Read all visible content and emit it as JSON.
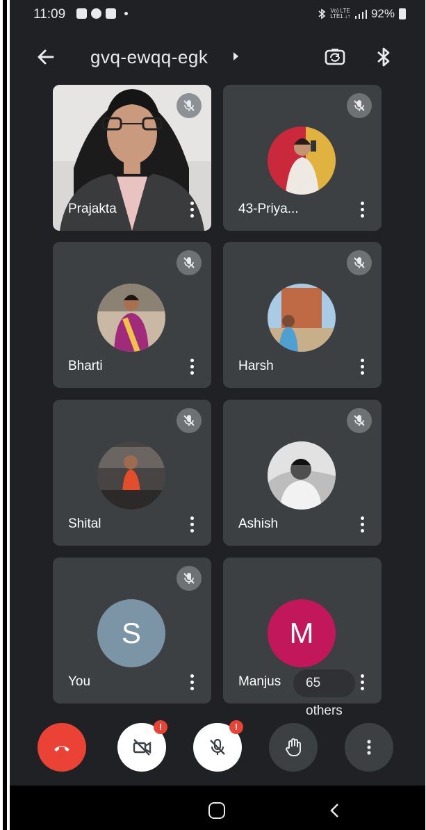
{
  "status_bar": {
    "time": "11:09",
    "net_top": "Vo) LTE",
    "net_bottom": "LTE1 ↓↑",
    "battery": "92%"
  },
  "header": {
    "meeting_code": "gvq-ewqq-egk",
    "back_icon": "arrow-left-icon",
    "switch_camera_icon": "switch-camera-icon",
    "bluetooth_icon": "bluetooth-icon"
  },
  "participants": [
    {
      "name": "Prajakta",
      "muted": true,
      "video_on": true
    },
    {
      "name": "43-Priya...",
      "muted": true,
      "video_on": false
    },
    {
      "name": "Bharti",
      "muted": true,
      "video_on": false
    },
    {
      "name": "Harsh",
      "muted": true,
      "video_on": false
    },
    {
      "name": "Shital",
      "muted": true,
      "video_on": false
    },
    {
      "name": "Ashish",
      "muted": true,
      "video_on": false
    },
    {
      "name": "You",
      "muted": true,
      "video_on": false,
      "initial": "S",
      "avatar_color": "#7b95a6"
    },
    {
      "name": "Manjus",
      "muted": false,
      "video_on": false,
      "initial": "M",
      "avatar_color": "#c2185b"
    }
  ],
  "others_label": "65 others",
  "controls": {
    "end_call_color": "#ea4335",
    "camera_badge": "!",
    "mic_badge": "!"
  }
}
